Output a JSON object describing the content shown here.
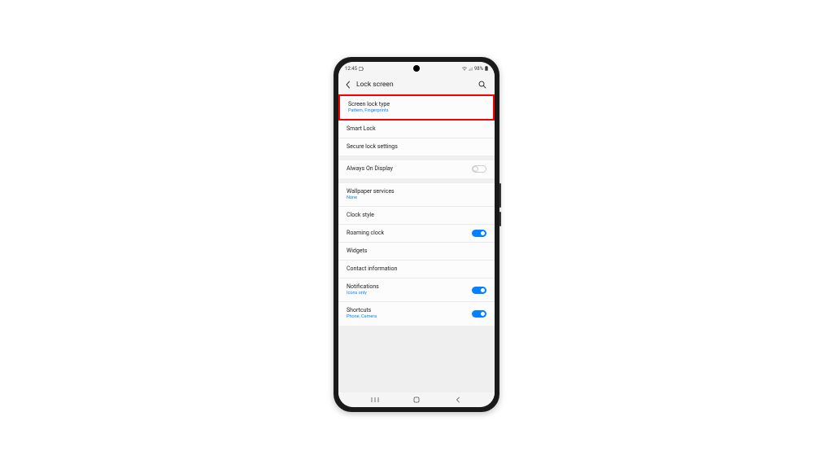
{
  "statusBar": {
    "time": "12:45",
    "battery": "98%"
  },
  "header": {
    "title": "Lock screen"
  },
  "groups": [
    {
      "items": [
        {
          "title": "Screen lock type",
          "subtitle": "Pattern, Fingerprints",
          "highlight": true
        },
        {
          "title": "Smart Lock"
        },
        {
          "title": "Secure lock settings"
        }
      ]
    },
    {
      "items": [
        {
          "title": "Always On Display",
          "toggle": "off"
        }
      ]
    },
    {
      "items": [
        {
          "title": "Wallpaper services",
          "subtitle": "None"
        },
        {
          "title": "Clock style"
        },
        {
          "title": "Roaming clock",
          "toggle": "on"
        },
        {
          "title": "Widgets"
        },
        {
          "title": "Contact information"
        },
        {
          "title": "Notifications",
          "subtitle": "Icons only",
          "toggle": "on"
        },
        {
          "title": "Shortcuts",
          "subtitle": "Phone, Camera",
          "toggle": "on"
        }
      ]
    }
  ]
}
